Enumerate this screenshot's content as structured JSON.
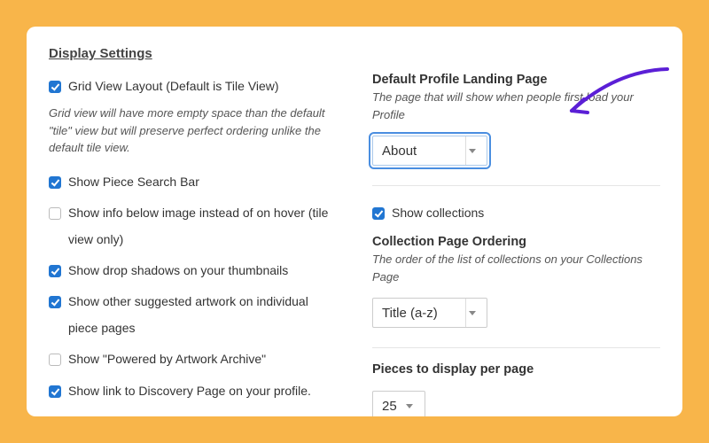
{
  "title": "Display Settings",
  "left": {
    "grid_label": "Grid View Layout (Default is Tile View)",
    "grid_desc": "Grid view will have more empty space than the default \"tile\" view but will preserve perfect ordering unlike the default tile view.",
    "search_label": "Show Piece Search Bar",
    "infobelow_label": "Show info below image instead of on hover (tile view only)",
    "shadows_label": "Show drop shadows on your thumbnails",
    "suggested_label": "Show other suggested artwork on individual piece pages",
    "powered_label": "Show \"Powered by Artwork Archive\"",
    "discovery_label": "Show link to Discovery Page on your profile."
  },
  "right": {
    "landing_heading": "Default Profile Landing Page",
    "landing_desc": "The page that will show when people first load your Profile",
    "landing_value": "About",
    "show_collections_label": "Show collections",
    "ordering_heading": "Collection Page Ordering",
    "ordering_desc": "The order of the list of collections on your Collections Page",
    "ordering_value": "Title (a-z)",
    "perpage_heading": "Pieces to display per page",
    "perpage_value": "25"
  }
}
